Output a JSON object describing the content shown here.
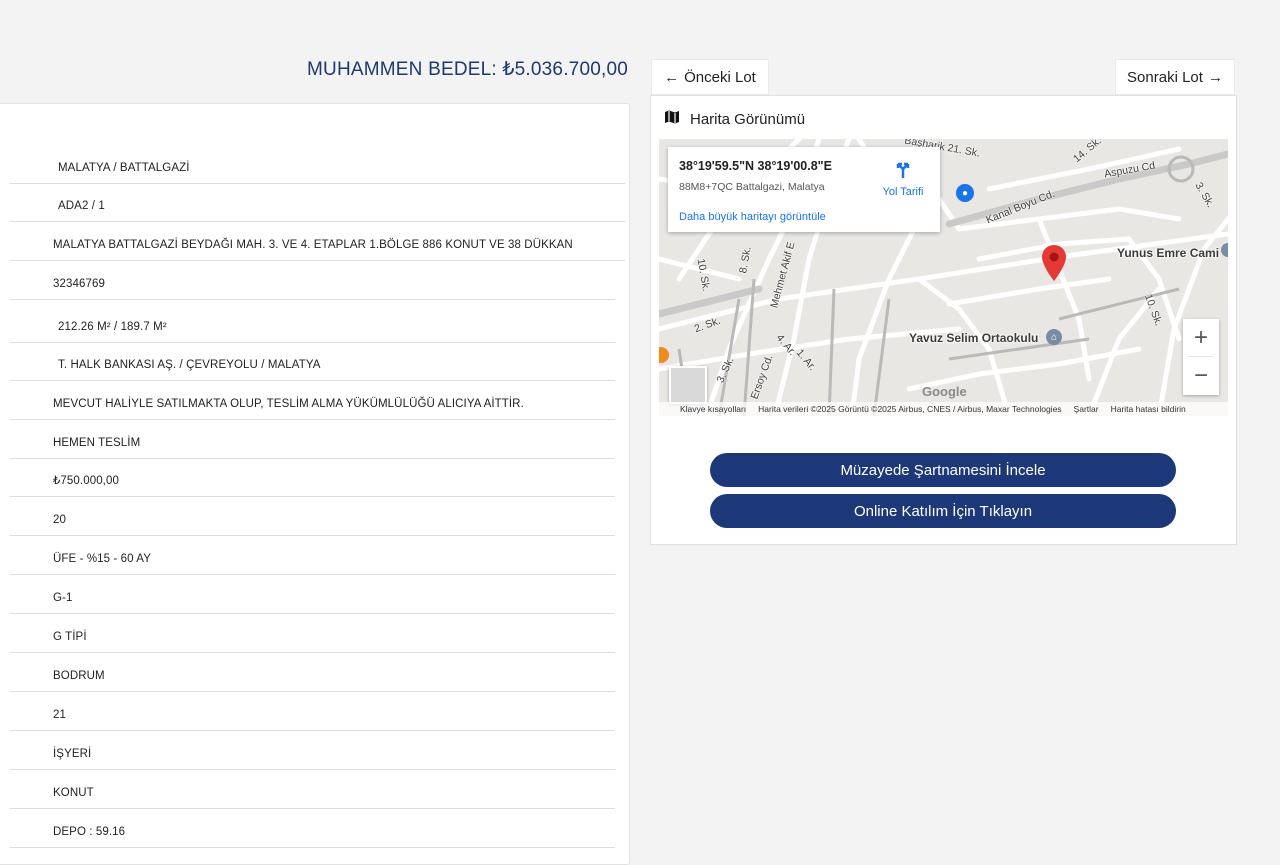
{
  "header": {
    "price_label": "MUHAMMEN BEDEL:",
    "price_value": "₺5.036.700,00"
  },
  "details": {
    "rows": [
      "MALATYA / BATTALGAZİ",
      "ADA2 / 1",
      "MALATYA BATTALGAZİ BEYDAĞI MAH. 3. VE 4. ETAPLAR 1.BÖLGE 886 KONUT VE 38 DÜKKAN",
      "32346769",
      "212.26 M² / 189.7 M²",
      "T. HALK BANKASI AŞ. / ÇEVREYOLU / MALATYA",
      "MEVCUT HALİYLE SATILMAKTA OLUP, TESLİM ALMA YÜKÜMLÜLÜĞÜ ALICIYA AİTTİR.",
      "HEMEN TESLİM",
      "₺750.000,00",
      "20",
      "ÜFE - %15 - 60 AY",
      "G-1",
      "G TİPİ",
      "BODRUM",
      "21",
      "İŞYERİ",
      "KONUT",
      "DEPO : 59.16"
    ]
  },
  "nav": {
    "prev_label": "Önceki Lot",
    "next_label": "Sonraki Lot"
  },
  "map_panel": {
    "title": "Harita Görünümü",
    "info": {
      "coords": "38°19'59.5\"N 38°19'00.8\"E",
      "address": "88M8+7QC Battalgazi, Malatya",
      "directions_label": "Yol Tarifi",
      "larger_map_link": "Daha büyük haritayı görüntüle"
    },
    "places": {
      "school": "Yavuz Selim Ortaokulu",
      "mosque": "Yunus Emre Cami",
      "road1": "Kanal Boyu Cd.",
      "road2": "Aspuzu Cd",
      "street1": "Mehmet Akif E",
      "street2": "10. Sk.",
      "street3": "8. Sk.",
      "street4": "2. Sk.",
      "street5": "14. Sk.",
      "street6": "3. Sk.",
      "street7": "Ersoy Cd.",
      "street8": "4. Ar.",
      "street9": "1. Ar.",
      "street10": "10. Sk.",
      "street11": "Başharik 21. Sk.",
      "street12": "3. Sk."
    },
    "google_logo": "Google",
    "attribution": {
      "shortcuts": "Klavye kısayolları",
      "data": "Harita verileri ©2025 Görüntü ©2025 Airbus, CNES / Airbus, Maxar Technologies",
      "terms": "Şartlar",
      "report": "Harita hatası bildirin"
    },
    "zoom_in": "+",
    "zoom_out": "−"
  },
  "actions": {
    "spec_button": "Müzayede Şartnamesini İncele",
    "online_button": "Online Katılım İçin Tıklayın"
  },
  "colors": {
    "primary": "#1c3878",
    "title": "#1d3a6e",
    "link": "#1a73e8",
    "marker": "#e53935"
  }
}
